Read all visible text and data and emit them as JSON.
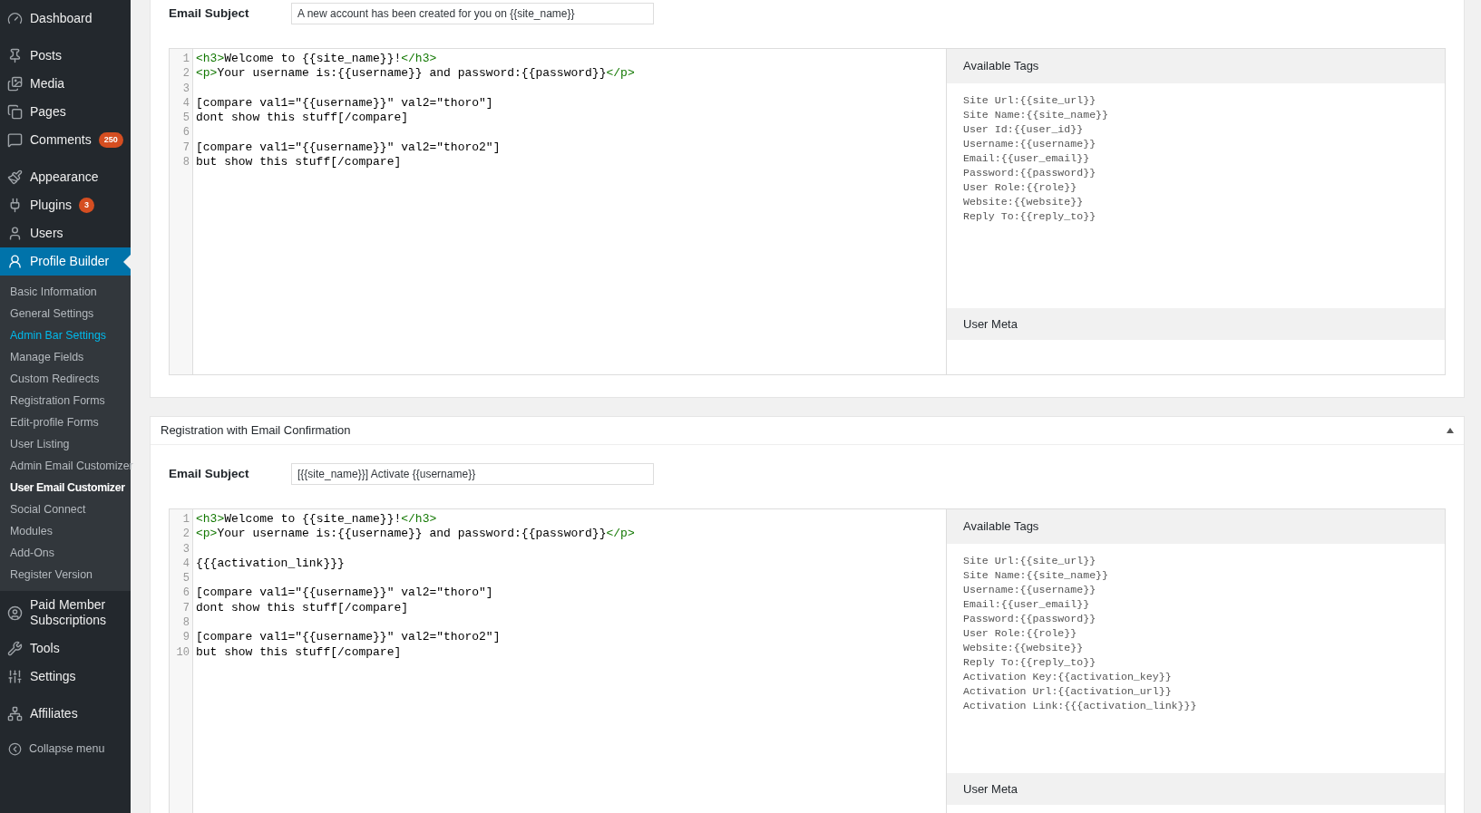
{
  "sidebar": {
    "menu_groups": [
      [
        {
          "label": "Dashboard",
          "selected": false
        }
      ],
      [
        {
          "label": "Posts",
          "selected": false
        },
        {
          "label": "Media",
          "selected": false
        },
        {
          "label": "Pages",
          "selected": false
        },
        {
          "label": "Comments",
          "badge": "250",
          "selected": false
        }
      ],
      [
        {
          "label": "Appearance",
          "selected": false
        },
        {
          "label": "Plugins",
          "badge": "3",
          "selected": false
        },
        {
          "label": "Users",
          "selected": false
        },
        {
          "label": "Profile Builder",
          "selected": true,
          "submenu": [
            {
              "label": "Basic Information",
              "selected": false,
              "hover": false
            },
            {
              "label": "General Settings",
              "selected": false,
              "hover": false
            },
            {
              "label": "Admin Bar Settings",
              "selected": false,
              "hover": true
            },
            {
              "label": "Manage Fields",
              "selected": false,
              "hover": false
            },
            {
              "label": "Custom Redirects",
              "selected": false,
              "hover": false
            },
            {
              "label": "Registration Forms",
              "selected": false,
              "hover": false
            },
            {
              "label": "Edit-profile Forms",
              "selected": false,
              "hover": false
            },
            {
              "label": "User Listing",
              "selected": false,
              "hover": false
            },
            {
              "label": "Admin Email Customizer",
              "selected": false,
              "hover": false
            },
            {
              "label": "User Email Customizer",
              "selected": true,
              "hover": false
            },
            {
              "label": "Social Connect",
              "selected": false,
              "hover": false
            },
            {
              "label": "Modules",
              "selected": false,
              "hover": false
            },
            {
              "label": "Add-Ons",
              "selected": false,
              "hover": false
            },
            {
              "label": "Register Version",
              "selected": false,
              "hover": false
            }
          ]
        },
        {
          "label": "Paid Member Subscriptions",
          "selected": false
        },
        {
          "label": "Tools",
          "selected": false
        },
        {
          "label": "Settings",
          "selected": false
        }
      ],
      [
        {
          "label": "Affiliates",
          "selected": false
        }
      ]
    ],
    "collapse": "Collapse menu"
  },
  "panels": [
    {
      "email_subject_label": "Email Subject",
      "email_subject": "A new account has been created for you on {{site_name}}",
      "code_lines": [
        {
          "number": "1",
          "segments": [
            {
              "kind": "tag",
              "text": "<h3>"
            },
            {
              "kind": "text",
              "text": "Welcome to {{site_name}}!"
            },
            {
              "kind": "tag",
              "text": "</h3>"
            }
          ]
        },
        {
          "number": "2",
          "segments": [
            {
              "kind": "tag",
              "text": "<p>"
            },
            {
              "kind": "text",
              "text": "Your username is:{{username}} and password:{{password}}"
            },
            {
              "kind": "tag",
              "text": "</p>"
            }
          ]
        },
        {
          "number": "3"
        },
        {
          "number": "4",
          "segments": [
            {
              "kind": "text",
              "text": "[compare val1=\"{{username}}\" val2=\"thoro\"]"
            }
          ]
        },
        {
          "number": "5",
          "segments": [
            {
              "kind": "text",
              "text": "dont show this stuff[/compare]"
            }
          ]
        },
        {
          "number": "6"
        },
        {
          "number": "7",
          "segments": [
            {
              "kind": "text",
              "text": "[compare val1=\"{{username}}\" val2=\"thoro2\"]"
            }
          ]
        },
        {
          "number": "8",
          "segments": [
            {
              "kind": "text",
              "text": "but show this stuff[/compare]"
            }
          ]
        }
      ],
      "available_tags_title": "Available Tags",
      "tags": [
        "Site Url:{{site_url}}",
        "Site Name:{{site_name}}",
        "User Id:{{user_id}}",
        "Username:{{username}}",
        "Email:{{user_email}}",
        "Password:{{password}}",
        "User Role:{{role}}",
        "Website:{{website}}",
        "Reply To:{{reply_to}}"
      ],
      "user_meta_title": "User Meta"
    },
    {
      "title": "Registration with Email Confirmation",
      "expanded": true,
      "email_subject_label": "Email Subject",
      "email_subject": "[{{site_name}}] Activate {{username}}",
      "code_lines": [
        {
          "number": "1",
          "segments": [
            {
              "kind": "tag",
              "text": "<h3>"
            },
            {
              "kind": "text",
              "text": "Welcome to {{site_name}}!"
            },
            {
              "kind": "tag",
              "text": "</h3>"
            }
          ]
        },
        {
          "number": "2",
          "segments": [
            {
              "kind": "tag",
              "text": "<p>"
            },
            {
              "kind": "text",
              "text": "Your username is:{{username}} and password:{{password}}"
            },
            {
              "kind": "tag",
              "text": "</p>"
            }
          ]
        },
        {
          "number": "3"
        },
        {
          "number": "4",
          "segments": [
            {
              "kind": "text",
              "text": "{{{activation_link}}}"
            }
          ]
        },
        {
          "number": "5"
        },
        {
          "number": "6",
          "segments": [
            {
              "kind": "text",
              "text": "[compare val1=\"{{username}}\" val2=\"thoro\"]"
            }
          ]
        },
        {
          "number": "7",
          "segments": [
            {
              "kind": "text",
              "text": "dont show this stuff[/compare]"
            }
          ]
        },
        {
          "number": "8"
        },
        {
          "number": "9",
          "segments": [
            {
              "kind": "text",
              "text": "[compare val1=\"{{username}}\" val2=\"thoro2\"]"
            }
          ]
        },
        {
          "number": "10",
          "segments": [
            {
              "kind": "text",
              "text": "but show this stuff[/compare]"
            }
          ]
        }
      ],
      "available_tags_title": "Available Tags",
      "tags": [
        "Site Url:{{site_url}}",
        "Site Name:{{site_name}}",
        "Username:{{username}}",
        "Email:{{user_email}}",
        "Password:{{password}}",
        "User Role:{{role}}",
        "Website:{{website}}",
        "Reply To:{{reply_to}}",
        "Activation Key:{{activation_key}}",
        "Activation Url:{{activation_url}}",
        "Activation Link:{{{activation_link}}}"
      ],
      "user_meta_title": "User Meta"
    }
  ]
}
